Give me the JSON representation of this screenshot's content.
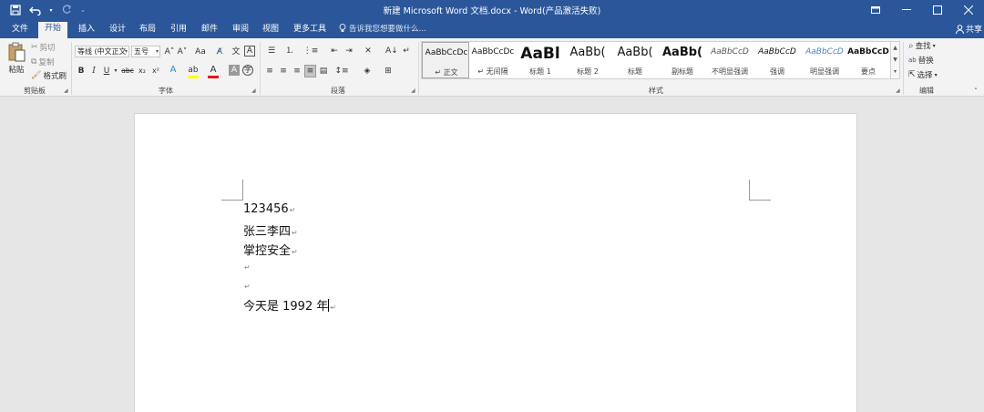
{
  "window": {
    "title": "新建 Microsoft Word 文档.docx - Word(产品激活失败)"
  },
  "tabs": [
    "文件",
    "开始",
    "插入",
    "设计",
    "布局",
    "引用",
    "邮件",
    "审阅",
    "视图",
    "更多工具"
  ],
  "active_tab": "开始",
  "tell_me": "告诉我您想要做什么...",
  "share": "共享",
  "clipboard": {
    "paste": "粘贴",
    "cut": "剪切",
    "copy": "复制",
    "format_painter": "格式刷",
    "label": "剪贴板"
  },
  "font": {
    "font_name": "等线 (中文正文",
    "font_size": "五号",
    "label": "字体",
    "bold": "B",
    "italic": "I",
    "underline": "U",
    "strike": "abc",
    "subscript": "x₂",
    "superscript": "x²",
    "grow": "A˄",
    "shrink": "A˅",
    "case": "Aa",
    "font_color": "#e81123",
    "highlight_color": "#ffff00"
  },
  "paragraph": {
    "label": "段落"
  },
  "styles": {
    "label": "样式",
    "items": [
      {
        "preview": "AaBbCcDc",
        "name": "↵ 正文"
      },
      {
        "preview": "AaBbCcDc",
        "name": "↵ 无间隔"
      },
      {
        "preview": "AaBl",
        "name": "标题 1"
      },
      {
        "preview": "AaBb(",
        "name": "标题 2"
      },
      {
        "preview": "AaBb(",
        "name": "标题"
      },
      {
        "preview": "AaBb(",
        "name": "副标题"
      },
      {
        "preview": "AaBbCcD",
        "name": "不明显强调"
      },
      {
        "preview": "AaBbCcD",
        "name": "强调"
      },
      {
        "preview": "AaBbCcD",
        "name": "明显强调"
      },
      {
        "preview": "AaBbCcD",
        "name": "要点"
      }
    ]
  },
  "editing": {
    "label": "编辑",
    "find": "查找",
    "replace": "替换",
    "select": "选择"
  },
  "document": {
    "lines": [
      "123456",
      "张三李四",
      "掌控安全",
      "",
      "",
      "今天是 1992 年"
    ],
    "paragraph_mark": "↵"
  },
  "colors": {
    "accent": "#2b579a",
    "ribbon": "#f3f3f3",
    "workspace": "#e6e6e6"
  }
}
